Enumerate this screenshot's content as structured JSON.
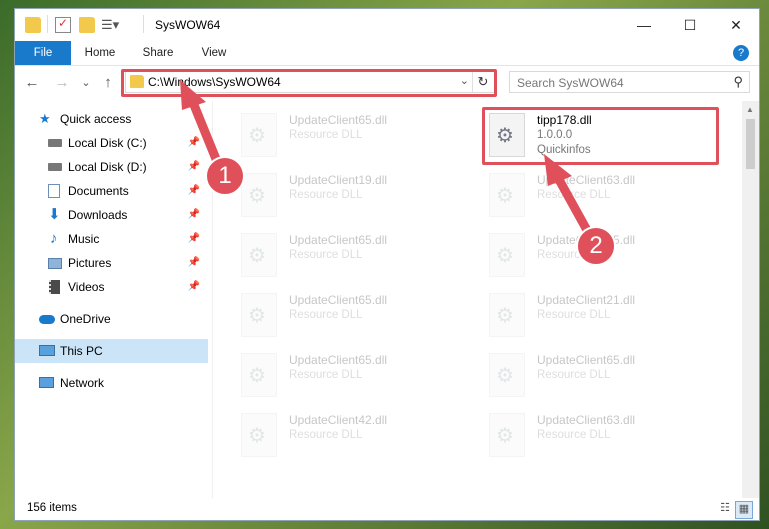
{
  "window": {
    "title": "SysWOW64",
    "controls": {
      "minimize": "—",
      "maximize": "☐",
      "close": "✕"
    }
  },
  "ribbon": {
    "tabs": [
      {
        "label": "File",
        "selected": true
      },
      {
        "label": "Home",
        "selected": false
      },
      {
        "label": "Share",
        "selected": false
      },
      {
        "label": "View",
        "selected": false
      }
    ],
    "help_icon": "?"
  },
  "navigation": {
    "back_icon": "←",
    "forward_icon": "→",
    "recent_icon": "⌄",
    "up_icon": "↑",
    "address": "C:\\Windows\\SysWOW64",
    "address_dropdown_icon": "⌄",
    "refresh_icon": "↻",
    "search_placeholder": "Search SysWOW64",
    "search_icon": "⚲"
  },
  "sidebar": {
    "items": [
      {
        "label": "Quick access",
        "icon": "star-icon",
        "pinned": false
      },
      {
        "label": "Local Disk (C:)",
        "icon": "drive-icon",
        "pinned": true
      },
      {
        "label": "Local Disk (D:)",
        "icon": "drive-icon",
        "pinned": true
      },
      {
        "label": "Documents",
        "icon": "documents-icon",
        "pinned": true
      },
      {
        "label": "Downloads",
        "icon": "download-icon",
        "pinned": true
      },
      {
        "label": "Music",
        "icon": "music-icon",
        "pinned": true
      },
      {
        "label": "Pictures",
        "icon": "pictures-icon",
        "pinned": true
      },
      {
        "label": "Videos",
        "icon": "videos-icon",
        "pinned": true
      },
      {
        "label": "OneDrive",
        "icon": "cloud-icon",
        "pinned": false
      },
      {
        "label": "This PC",
        "icon": "computer-icon",
        "pinned": false,
        "selected": true
      },
      {
        "label": "Network",
        "icon": "network-icon",
        "pinned": false
      }
    ],
    "pin_glyph": "📌"
  },
  "files": {
    "left_column": [
      {
        "name": "UpdateClient65.dll",
        "type": "Resource DLL"
      },
      {
        "name": "UpdateClient19.dll",
        "type": "Resource DLL"
      },
      {
        "name": "UpdateClient65.dll",
        "type": "Resource DLL"
      },
      {
        "name": "UpdateClient65.dll",
        "type": "Resource DLL"
      },
      {
        "name": "UpdateClient65.dll",
        "type": "Resource DLL"
      },
      {
        "name": "UpdateClient42.dll",
        "type": "Resource DLL"
      }
    ],
    "right_column": [
      {
        "name": "tipp178.dll",
        "version": "1.0.0.0",
        "description": "Quickinfos"
      },
      {
        "name": "UpdateClient63.dll",
        "type": "Resource DLL"
      },
      {
        "name": "UpdateClient65.dll",
        "type": "Resource DLL"
      },
      {
        "name": "UpdateClient21.dll",
        "type": "Resource DLL"
      },
      {
        "name": "UpdateClient65.dll",
        "type": "Resource DLL"
      },
      {
        "name": "UpdateClient63.dll",
        "type": "Resource DLL"
      }
    ]
  },
  "annotations": {
    "step1": "1",
    "step2": "2"
  },
  "status": {
    "item_count": "156 items"
  },
  "colors": {
    "accent": "#1979ca",
    "highlight": "#e0505a",
    "selection": "#cce4f7"
  }
}
